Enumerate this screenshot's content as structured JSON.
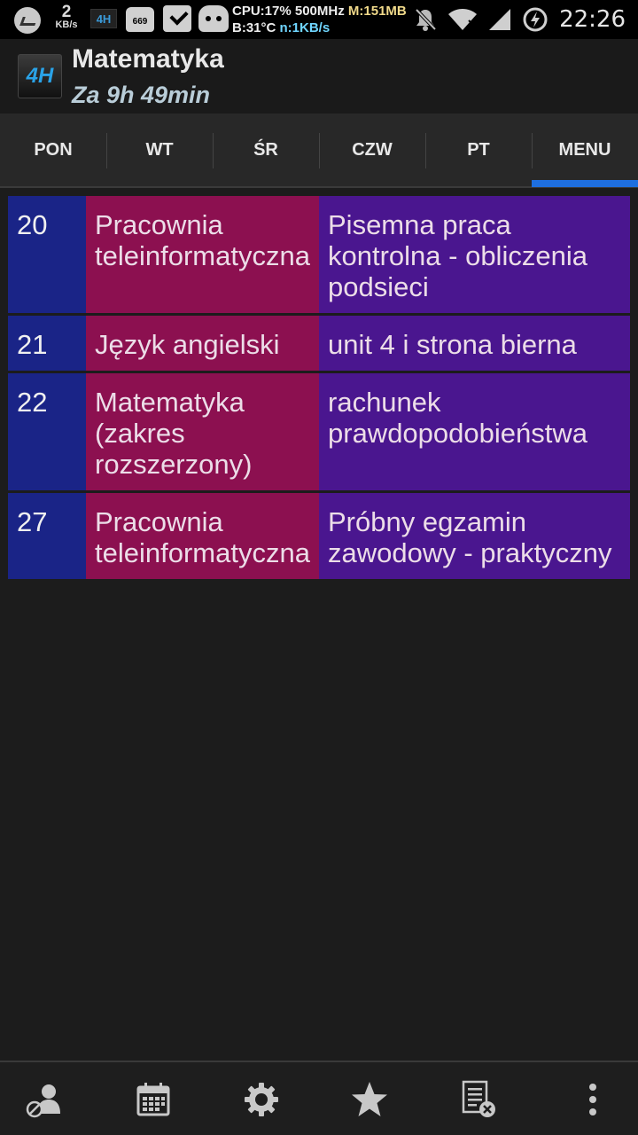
{
  "status_bar": {
    "speed_value": "2",
    "speed_unit": "KB/s",
    "app_badge": "4H",
    "badge_number": "669",
    "cpu_line": "CPU:17% 500MHz",
    "mem_line": "M:151MB",
    "temp_line": "B:31°C",
    "net_line": "n:1KB/s",
    "time": "22:26"
  },
  "header": {
    "logo_text": "4H",
    "title": "Matematyka",
    "subtitle": "Za 9h 49min"
  },
  "tabs": [
    {
      "label": "PON"
    },
    {
      "label": "WT"
    },
    {
      "label": "ŚR"
    },
    {
      "label": "CZW"
    },
    {
      "label": "PT"
    },
    {
      "label": "MENU"
    }
  ],
  "active_tab": "MENU",
  "rows": [
    {
      "day": "20",
      "subject": "Pracownia teleinformatyczna",
      "description": "Pisemna praca kontrolna - obliczenia podsieci"
    },
    {
      "day": "21",
      "subject": "Język angielski",
      "description": "unit 4 i strona bierna"
    },
    {
      "day": "22",
      "subject": "Matematyka (zakres rozszerzony)",
      "description": "rachunek prawdopodobieństwa"
    },
    {
      "day": "27",
      "subject": "Pracownia teleinformatyczna",
      "description": "Próbny egzamin zawodowy - praktyczny"
    }
  ],
  "colors": {
    "day_cell": "#1a2487",
    "subject_cell": "#8c1050",
    "description_cell": "#4a168f",
    "tab_indicator": "#1e6fe0"
  },
  "bottom_bar": {
    "icons": [
      "profile-blocked-icon",
      "calendar-icon",
      "settings-gear-icon",
      "star-icon",
      "list-remove-icon",
      "overflow-menu-icon"
    ]
  }
}
